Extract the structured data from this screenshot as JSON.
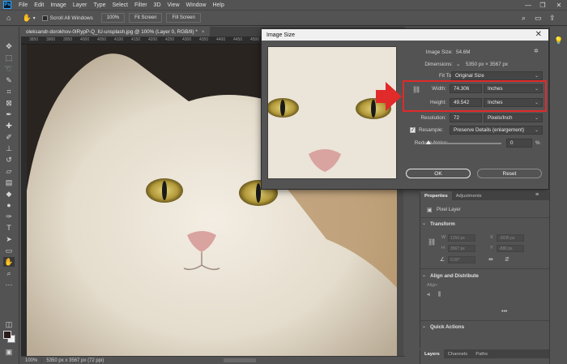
{
  "menubar": {
    "logo": "Ps",
    "items": [
      "File",
      "Edit",
      "Image",
      "Layer",
      "Type",
      "Select",
      "Filter",
      "3D",
      "View",
      "Window",
      "Help"
    ],
    "window_controls": [
      "—",
      "❐",
      "✕"
    ]
  },
  "options": {
    "scroll_all_label": "Scroll All Windows",
    "zoom_value": "100%",
    "fit_screen_label": "Fit Screen",
    "fill_screen_label": "Fill Screen"
  },
  "document": {
    "tab_title": "oleksandr-dorokhov-0IRypP-Q_IU-unsplash.jpg @ 100% (Layer 0, RGB/8) *",
    "tab_close": "×",
    "ruler_ticks": [
      "3850",
      "3900",
      "3950",
      "4000",
      "4050",
      "4100",
      "4150",
      "4200",
      "4250",
      "4300",
      "4350",
      "4400",
      "4450",
      "4500",
      "4550",
      "4600",
      "4650",
      "4700",
      "4750",
      "4800"
    ]
  },
  "status": {
    "zoom": "100%",
    "doc_info": "5350 px x 3567 px (72 ppi)"
  },
  "dialog": {
    "title": "Image Size",
    "close": "✕",
    "image_size_label": "Image Size:",
    "image_size_value": "54.6M",
    "dimensions_label": "Dimensions:",
    "dimensions_value": "5350 px  ×  3567 px",
    "fit_to_label": "Fit To:",
    "fit_to_value": "Original Size",
    "width_label": "Width:",
    "width_value": "74.306",
    "width_unit": "Inches",
    "height_label": "Height:",
    "height_value": "49.542",
    "height_unit": "Inches",
    "resolution_label": "Resolution:",
    "resolution_value": "72",
    "resolution_unit": "Pixels/Inch",
    "resample_label": "Resample:",
    "resample_value": "Preserve Details (enlargement)",
    "reduce_noise_label": "Reduce Noise:",
    "reduce_noise_value": "0",
    "reduce_noise_unit": "%",
    "ok_label": "OK",
    "reset_label": "Reset"
  },
  "properties": {
    "tabs": [
      "Properties",
      "Adjustments"
    ],
    "layer_type": "Pixel Layer",
    "transform_head": "Transform",
    "tf_w_label": "W",
    "tf_w_value": "1250 px",
    "tf_x_label": "X",
    "tf_x_value": "-3035 px",
    "tf_h_label": "H",
    "tf_h_value": "3567 px",
    "tf_y_label": "Y",
    "tf_y_value": "-880 px",
    "tf_angle_value": "0.00°",
    "align_head": "Align and Distribute",
    "align_label": "Align:",
    "quick_actions_head": "Quick Actions"
  },
  "layers": {
    "tabs": [
      "Layers",
      "Channels",
      "Paths"
    ]
  },
  "colors": {
    "highlight": "#e12a2a",
    "panel_bg": "#535353"
  }
}
